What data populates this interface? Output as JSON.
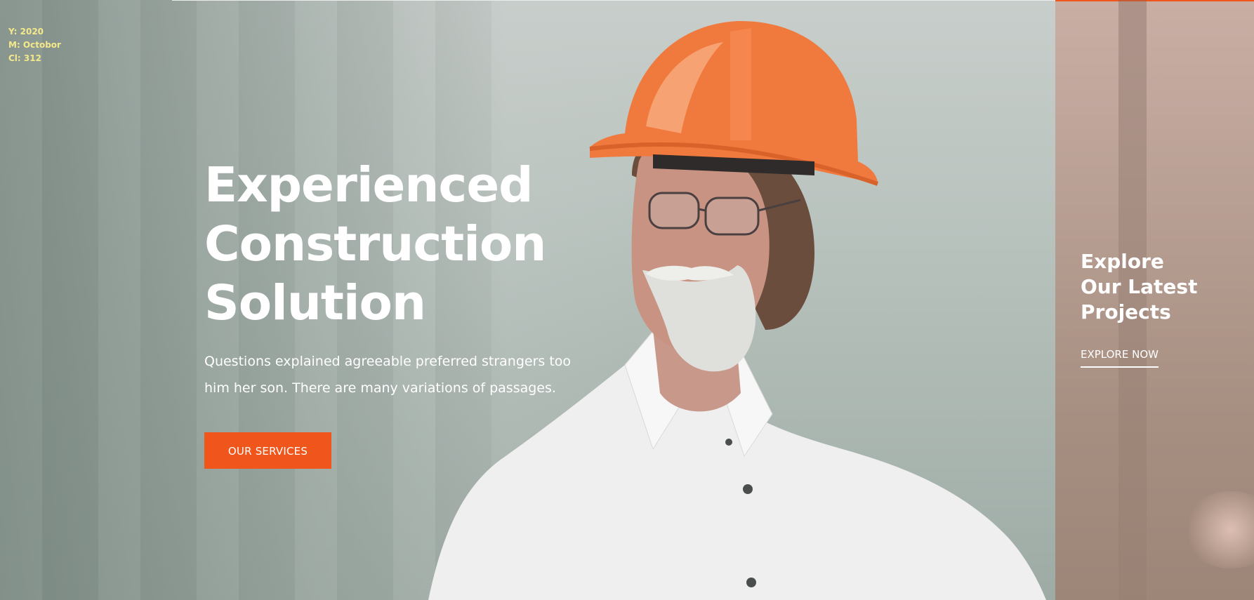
{
  "overlay_stats": {
    "year": "Y: 2020",
    "month": "M: Octobor",
    "count": "Cl: 312"
  },
  "hero": {
    "title_line1": "Experienced",
    "title_line2": "Construction",
    "title_line3": "Solution",
    "text_line1": "Questions explained agreeable preferred strangers too",
    "text_line2": "him her son. There are many variations of passages.",
    "cta_label": "OUR SERVICES"
  },
  "side_panel": {
    "title_line1": "Explore",
    "title_line2": "Our Latest",
    "title_line3": "Projects",
    "link_label": "EXPLORE NOW"
  },
  "colors": {
    "accent": "#f0561b",
    "helmet": "#f07a3e",
    "overlay_text": "#f3e98a",
    "side_panel": "#b89f93"
  }
}
